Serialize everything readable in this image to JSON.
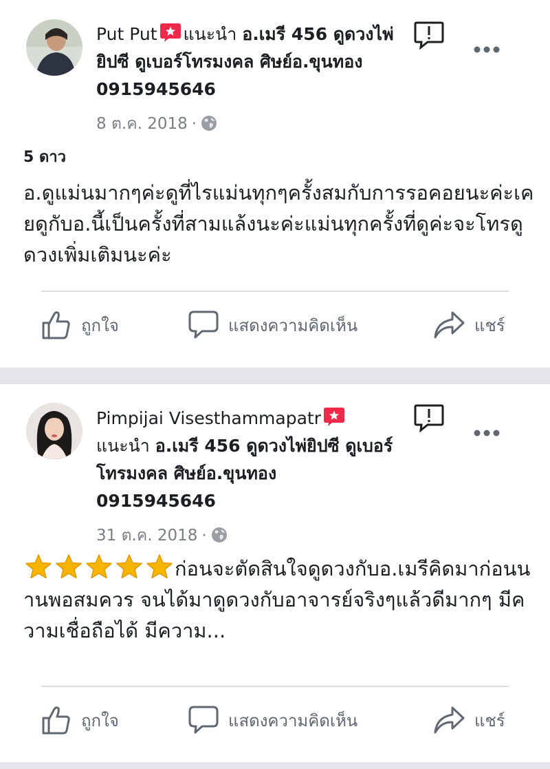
{
  "reviews": [
    {
      "author": "Put Put",
      "recommend_verb": "แนะนำ",
      "page_name": "อ.เมรี 456 ดูดวงไพ่ยิปซี ดูเบอร์โทรมงคล ศิษย์อ.ขุนทอง 0915945646",
      "date": "8 ต.ค. 2018",
      "rating_text": "5 ดาว",
      "text": "อ.ดูแม่นมากๆค่ะดูที่ไรแม่นทุกๆครั้งสมกับการรอคอยนะค่ะเคยดูกับอ.นี้เป็นครั้งที่สามแล้งนะค่ะแม่นทุกครั้งที่ดูค่ะจะโทรดูดวงเพิ่มเติมนะค่ะ"
    },
    {
      "author": "Pimpijai Visesthammapatr",
      "recommend_verb": "แนะนำ",
      "page_name": "อ.เมรี 456 ดูดวงไพ่ยิปซี ดูเบอร์โทรมงคล ศิษย์อ.ขุนทอง 0915945646",
      "date": "31 ต.ค. 2018",
      "stars": 5,
      "text": "ก่อนจะตัดสินใจดูดวงกับอ.เมรีคิดมาก่อนนานพอสมควร จนได้มาดูดวงกับอาจารย์จริงๆแล้วดีมากๆ มีความเชื่อถือได้ มีความ..."
    }
  ],
  "actions": {
    "like": "ถูกใจ",
    "comment": "แสดงความคิดเห็น",
    "share": "แชร์"
  },
  "colors": {
    "recommend_badge": "#f0284a",
    "star": "#f7b500",
    "meta_text": "#7c7e83",
    "action_text": "#606770",
    "separator": "#e4e5e9"
  },
  "icons": {
    "recommend": "recommend-badge-icon",
    "flag": "report-flag-icon",
    "more": "more-options-icon",
    "globe": "globe-icon",
    "like": "thumbs-up-icon",
    "comment": "comment-bubble-icon",
    "share": "share-arrow-icon"
  }
}
